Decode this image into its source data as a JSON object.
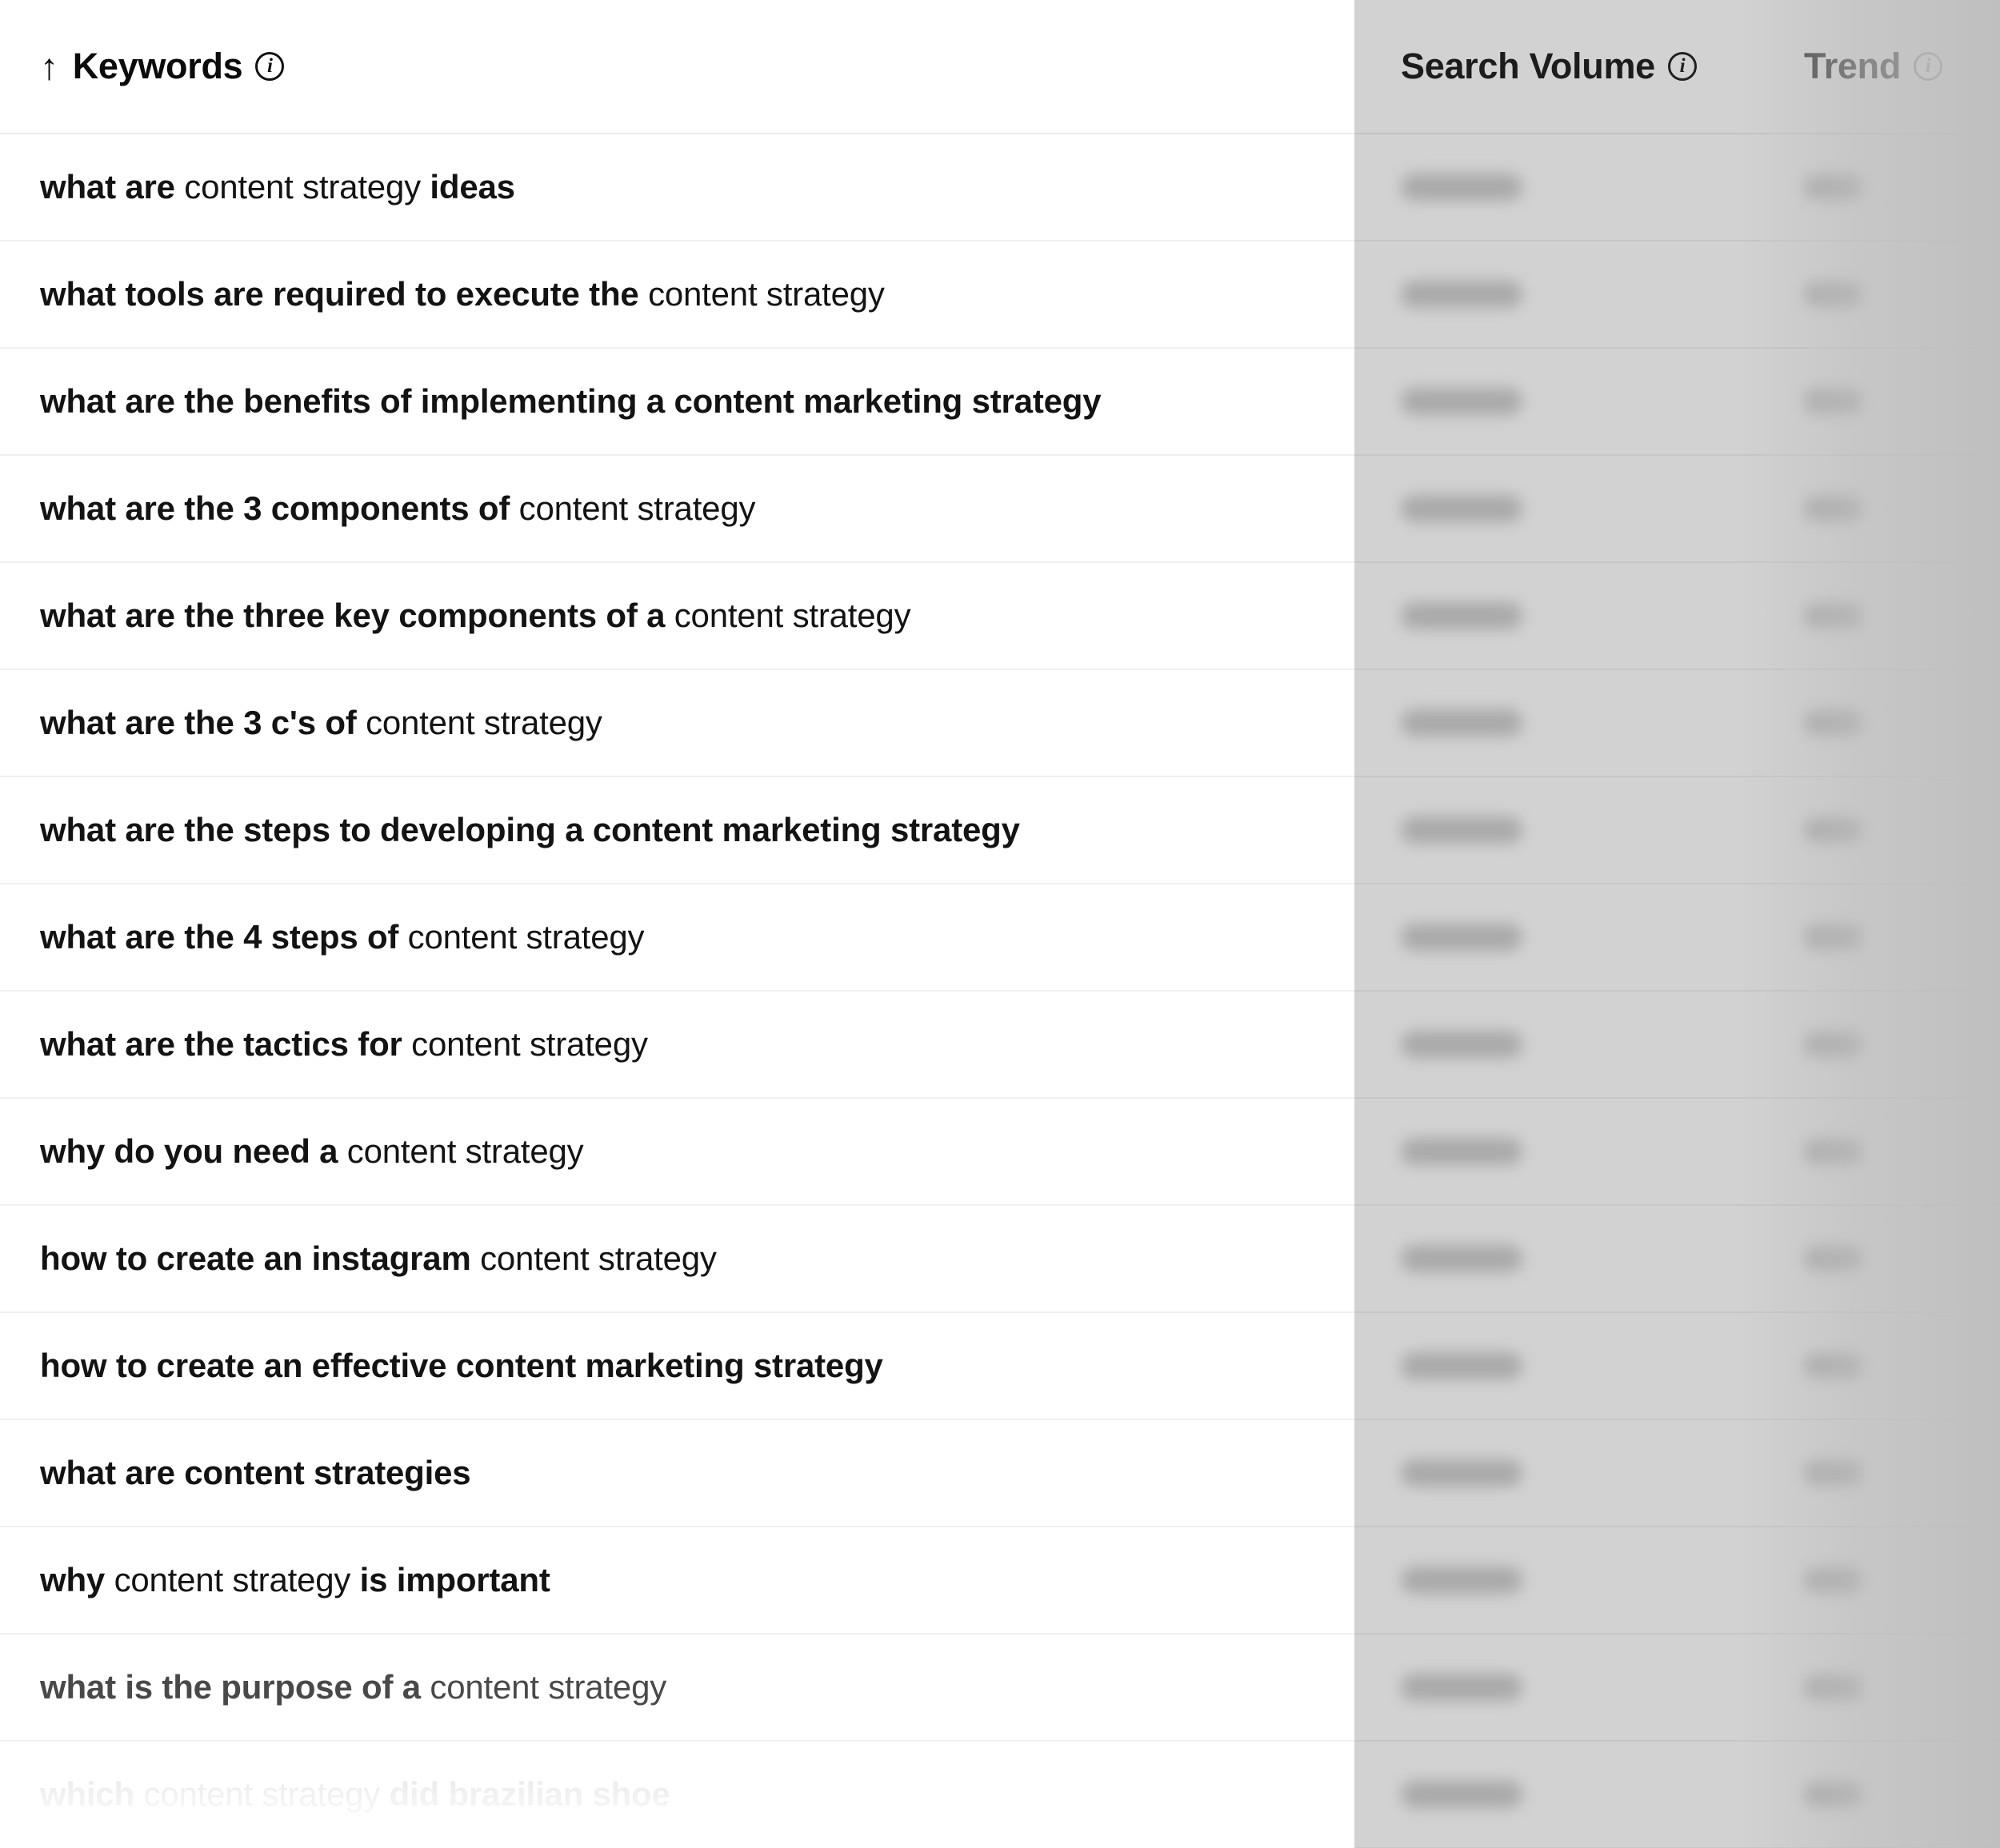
{
  "table": {
    "columns": [
      {
        "id": "keywords",
        "label": "Keywords",
        "sort_indicator": "↑",
        "info_icon": "info-circle-icon",
        "sorted": true
      },
      {
        "id": "search_volume",
        "label": "Search Volume",
        "info_icon": "info-circle-icon",
        "obscured": true
      },
      {
        "id": "trend",
        "label": "Trend",
        "info_icon": "info-circle-icon",
        "obscured": true
      }
    ],
    "rows": [
      {
        "parts": [
          {
            "text": "what are ",
            "bold": true
          },
          {
            "text": "content strategy ",
            "bold": false
          },
          {
            "text": "ideas",
            "bold": true
          }
        ],
        "plain": "what are content strategy ideas",
        "search_volume": "",
        "trend": "",
        "fade": 0
      },
      {
        "parts": [
          {
            "text": "what tools are required to execute the ",
            "bold": true
          },
          {
            "text": "content strategy",
            "bold": false
          }
        ],
        "plain": "what tools are required to execute the content strategy",
        "search_volume": "",
        "trend": "",
        "fade": 0
      },
      {
        "parts": [
          {
            "text": "what are the benefits of implementing a content marketing strategy",
            "bold": true
          }
        ],
        "plain": "what are the benefits of implementing a content marketing strategy",
        "search_volume": "",
        "trend": "",
        "fade": 0
      },
      {
        "parts": [
          {
            "text": "what are the 3 components of ",
            "bold": true
          },
          {
            "text": "content strategy",
            "bold": false
          }
        ],
        "plain": "what are the 3 components of content strategy",
        "search_volume": "",
        "trend": "",
        "fade": 0
      },
      {
        "parts": [
          {
            "text": "what are the three key components of a ",
            "bold": true
          },
          {
            "text": "content strategy",
            "bold": false
          }
        ],
        "plain": "what are the three key components of a content strategy",
        "search_volume": "",
        "trend": "",
        "fade": 0
      },
      {
        "parts": [
          {
            "text": "what are the 3 c's of ",
            "bold": true
          },
          {
            "text": "content strategy",
            "bold": false
          }
        ],
        "plain": "what are the 3 c's of content strategy",
        "search_volume": "",
        "trend": "",
        "fade": 0
      },
      {
        "parts": [
          {
            "text": "what are the steps to developing a content marketing strategy",
            "bold": true
          }
        ],
        "plain": "what are the steps to developing a content marketing strategy",
        "search_volume": "",
        "trend": "",
        "fade": 0
      },
      {
        "parts": [
          {
            "text": "what are the 4 steps of ",
            "bold": true
          },
          {
            "text": "content strategy",
            "bold": false
          }
        ],
        "plain": "what are the 4 steps of content strategy",
        "search_volume": "",
        "trend": "",
        "fade": 0
      },
      {
        "parts": [
          {
            "text": "what are the tactics for ",
            "bold": true
          },
          {
            "text": "content strategy",
            "bold": false
          }
        ],
        "plain": "what are the tactics for content strategy",
        "search_volume": "",
        "trend": "",
        "fade": 0
      },
      {
        "parts": [
          {
            "text": "why do you need a ",
            "bold": true
          },
          {
            "text": "content strategy",
            "bold": false
          }
        ],
        "plain": "why do you need a content strategy",
        "search_volume": "",
        "trend": "",
        "fade": 0
      },
      {
        "parts": [
          {
            "text": "how to create an instagram ",
            "bold": true
          },
          {
            "text": "content strategy",
            "bold": false
          }
        ],
        "plain": "how to create an instagram content strategy",
        "search_volume": "",
        "trend": "",
        "fade": 0
      },
      {
        "parts": [
          {
            "text": "how to create an effective content marketing strategy",
            "bold": true
          }
        ],
        "plain": "how to create an effective content marketing strategy",
        "search_volume": "",
        "trend": "",
        "fade": 0
      },
      {
        "parts": [
          {
            "text": "what are content strategies",
            "bold": true
          }
        ],
        "plain": "what are content strategies",
        "search_volume": "",
        "trend": "",
        "fade": 0
      },
      {
        "parts": [
          {
            "text": "why ",
            "bold": true
          },
          {
            "text": "content strategy ",
            "bold": false
          },
          {
            "text": "is important",
            "bold": true
          }
        ],
        "plain": "why content strategy is important",
        "search_volume": "",
        "trend": "",
        "fade": 0
      },
      {
        "parts": [
          {
            "text": "what is the purpose of a ",
            "bold": true
          },
          {
            "text": "content strategy",
            "bold": false
          }
        ],
        "plain": "what is the purpose of a content strategy",
        "search_volume": "",
        "trend": "",
        "fade": 1
      },
      {
        "parts": [
          {
            "text": "which ",
            "bold": true
          },
          {
            "text": "content strategy ",
            "bold": false
          },
          {
            "text": "did brazilian shoe",
            "bold": true
          }
        ],
        "plain": "which content strategy did brazilian shoe",
        "search_volume": "",
        "trend": "",
        "fade": 2
      }
    ]
  },
  "colors": {
    "page_background": "#ffffff",
    "row_divider": "#f0f0f0",
    "text_primary": "#131313",
    "header_text": "#0b0b0b",
    "obscure_overlay": "#bebebe",
    "blur_pill": "#a9a9a9"
  }
}
